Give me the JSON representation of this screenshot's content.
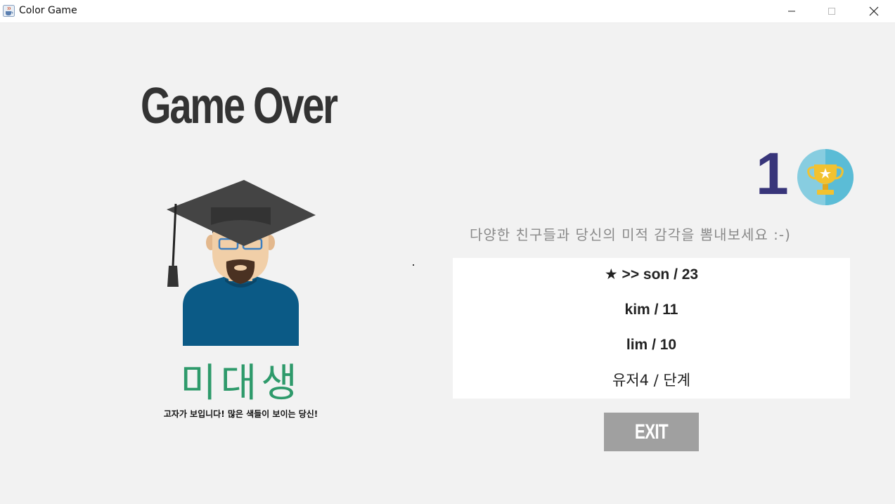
{
  "window": {
    "title": "Color Game",
    "icon": "java-cup-icon"
  },
  "main": {
    "heading": "Game Over",
    "rank_name": "미대생",
    "rank_description": "고자가 보입니다! 많은 색들이 보이는 당신!",
    "my_rank": "1",
    "trophy_icon": "trophy-icon",
    "subtitle": "다양한 친구들과 당신의 미적 감각을 뽐내보세요 :-)",
    "leaderboard": [
      {
        "text": "★ >> son / 23"
      },
      {
        "text": "kim / 11"
      },
      {
        "text": "lim / 10"
      },
      {
        "text": "유저4 / 단계"
      }
    ],
    "exit_label": "EXIT"
  },
  "colors": {
    "background": "#f2f2f2",
    "heading": "#333333",
    "rank_name": "#2e9a6b",
    "my_rank": "#38357a",
    "badge": "#5bbcd6",
    "exit_button": "#a0a0a0"
  }
}
